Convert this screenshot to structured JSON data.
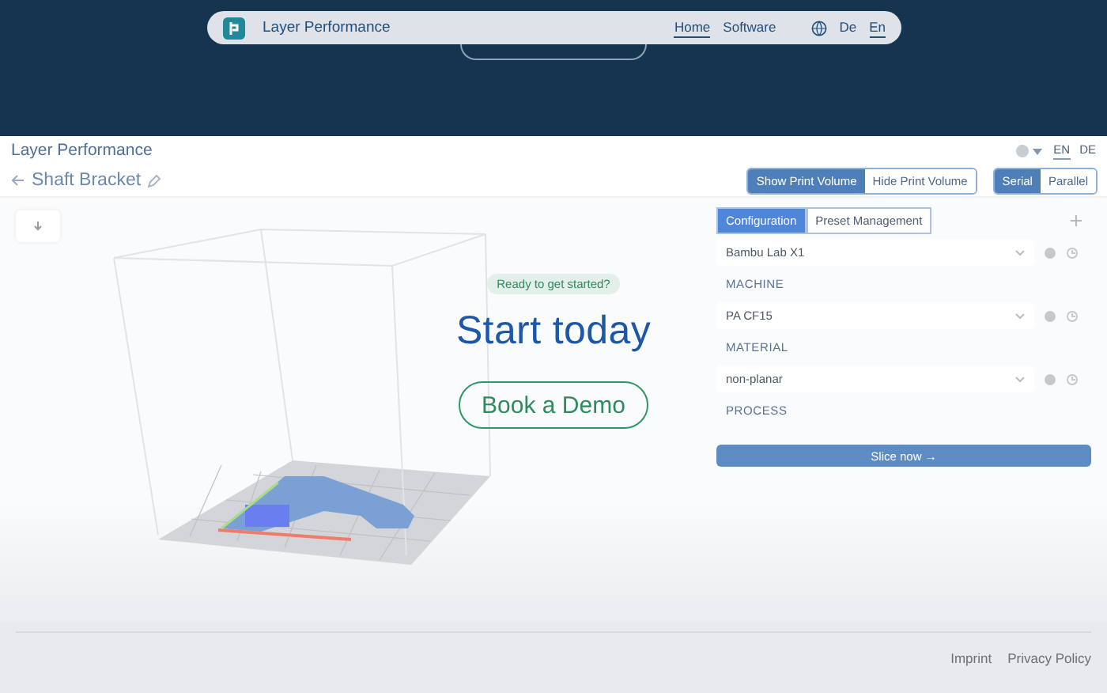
{
  "nav": {
    "brand": "Layer Performance",
    "links": [
      {
        "label": "Home",
        "selected": true
      },
      {
        "label": "Software",
        "selected": false
      }
    ],
    "languages": [
      {
        "label": "De",
        "selected": false
      },
      {
        "label": "En",
        "selected": true
      }
    ]
  },
  "app_preview": {
    "title": "Layer Performance",
    "languages": [
      {
        "label": "EN",
        "selected": true
      },
      {
        "label": "DE",
        "selected": false
      }
    ],
    "project": "Shaft Bracket",
    "volume_toggle": [
      {
        "label": "Show Print Volume",
        "selected": true
      },
      {
        "label": "Hide Print Volume",
        "selected": false
      }
    ],
    "mode_toggle": [
      {
        "label": "Serial",
        "selected": true
      },
      {
        "label": "Parallel",
        "selected": false
      }
    ],
    "panel_tabs": [
      {
        "label": "Configuration",
        "selected": true
      },
      {
        "label": "Preset Management",
        "selected": false
      }
    ],
    "presets": [
      {
        "value": "Bambu Lab X1",
        "label": "MACHINE"
      },
      {
        "value": "PA CF15",
        "label": "MATERIAL"
      },
      {
        "value": "non-planar",
        "label": "PROCESS"
      }
    ],
    "slice_button": "Slice now →"
  },
  "cta": {
    "badge": "Ready to get started?",
    "title": "Start today",
    "button": "Book a Demo"
  },
  "footer": {
    "links": [
      "Imprint",
      "Privacy Policy"
    ]
  }
}
